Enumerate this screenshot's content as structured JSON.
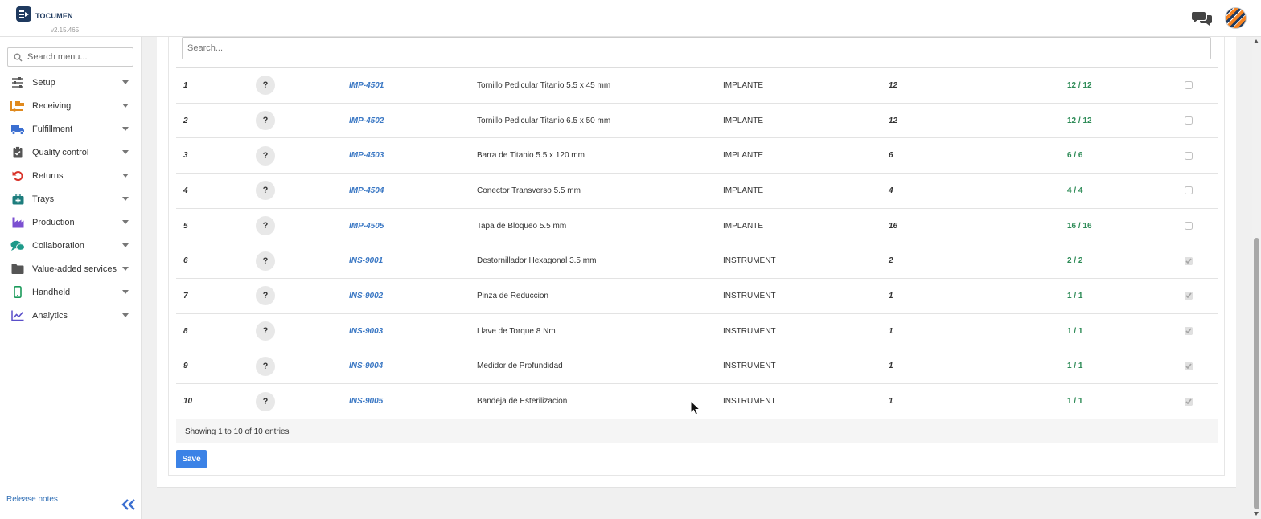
{
  "app": {
    "name": "TOCUMEN",
    "version": "v2.15.465"
  },
  "sidebar": {
    "search_placeholder": "Search menu...",
    "items": [
      {
        "label": "Setup",
        "icon": "sliders-icon",
        "color": "#555555"
      },
      {
        "label": "Receiving",
        "icon": "dolly-icon",
        "color": "#e08a1e"
      },
      {
        "label": "Fulfillment",
        "icon": "truck-icon",
        "color": "#3b6fd1"
      },
      {
        "label": "Quality control",
        "icon": "clipboard-check-icon",
        "color": "#555555"
      },
      {
        "label": "Returns",
        "icon": "undo-icon",
        "color": "#d9342b"
      },
      {
        "label": "Trays",
        "icon": "medkit-icon",
        "color": "#1d7d7d"
      },
      {
        "label": "Production",
        "icon": "factory-icon",
        "color": "#7b4fd1"
      },
      {
        "label": "Collaboration",
        "icon": "comments-icon",
        "color": "#1d9a8a"
      },
      {
        "label": "Value-added services",
        "icon": "folder-icon",
        "color": "#555555"
      },
      {
        "label": "Handheld",
        "icon": "mobile-icon",
        "color": "#1a9a5a"
      },
      {
        "label": "Analytics",
        "icon": "line-chart-icon",
        "color": "#5a4fc9"
      }
    ],
    "release_notes": "Release notes"
  },
  "table": {
    "search_placeholder": "Search...",
    "rows": [
      {
        "num": "1",
        "q": "?",
        "code": "IMP-4501",
        "desc": "Tornillo Pedicular Titanio 5.5 x 45 mm",
        "type": "IMPLANTE",
        "qty": "12",
        "ratio": "12 / 12",
        "checked": false
      },
      {
        "num": "2",
        "q": "?",
        "code": "IMP-4502",
        "desc": "Tornillo Pedicular Titanio 6.5 x 50 mm",
        "type": "IMPLANTE",
        "qty": "12",
        "ratio": "12 / 12",
        "checked": false
      },
      {
        "num": "3",
        "q": "?",
        "code": "IMP-4503",
        "desc": "Barra de Titanio 5.5 x 120 mm",
        "type": "IMPLANTE",
        "qty": "6",
        "ratio": "6 / 6",
        "checked": false
      },
      {
        "num": "4",
        "q": "?",
        "code": "IMP-4504",
        "desc": "Conector Transverso 5.5 mm",
        "type": "IMPLANTE",
        "qty": "4",
        "ratio": "4 / 4",
        "checked": false
      },
      {
        "num": "5",
        "q": "?",
        "code": "IMP-4505",
        "desc": "Tapa de Bloqueo 5.5 mm",
        "type": "IMPLANTE",
        "qty": "16",
        "ratio": "16 / 16",
        "checked": false
      },
      {
        "num": "6",
        "q": "?",
        "code": "INS-9001",
        "desc": "Destornillador Hexagonal 3.5 mm",
        "type": "INSTRUMENT",
        "qty": "2",
        "ratio": "2 / 2",
        "checked": true
      },
      {
        "num": "7",
        "q": "?",
        "code": "INS-9002",
        "desc": "Pinza de Reduccion",
        "type": "INSTRUMENT",
        "qty": "1",
        "ratio": "1 / 1",
        "checked": true
      },
      {
        "num": "8",
        "q": "?",
        "code": "INS-9003",
        "desc": "Llave de Torque 8 Nm",
        "type": "INSTRUMENT",
        "qty": "1",
        "ratio": "1 / 1",
        "checked": true
      },
      {
        "num": "9",
        "q": "?",
        "code": "INS-9004",
        "desc": "Medidor de Profundidad",
        "type": "INSTRUMENT",
        "qty": "1",
        "ratio": "1 / 1",
        "checked": true
      },
      {
        "num": "10",
        "q": "?",
        "code": "INS-9005",
        "desc": "Bandeja de Esterilizacion",
        "type": "INSTRUMENT",
        "qty": "1",
        "ratio": "1 / 1",
        "checked": true
      }
    ],
    "footer": "Showing 1 to 10 of 10 entries",
    "save_label": "Save"
  }
}
